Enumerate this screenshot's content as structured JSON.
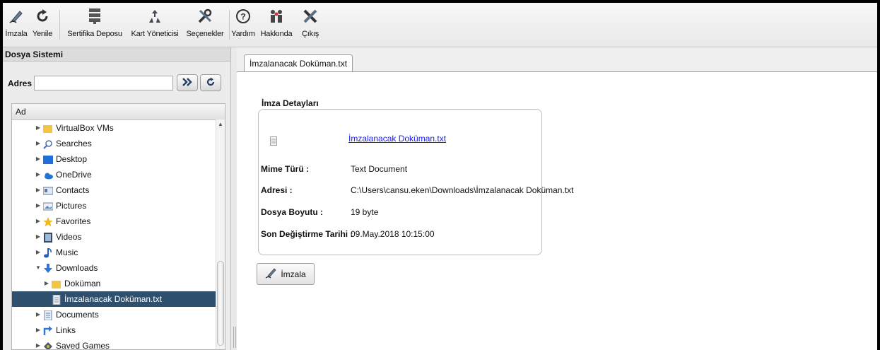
{
  "toolbar": {
    "items": [
      {
        "label": "İmzala",
        "icon": "sign-pen-icon"
      },
      {
        "label": "Yenile",
        "icon": "refresh-icon"
      },
      {
        "label": "Sertifika Deposu",
        "icon": "certificate-store-icon"
      },
      {
        "label": "Kart Yöneticisi",
        "icon": "card-manager-icon"
      },
      {
        "label": "Seçenekler",
        "icon": "wrench-icon"
      },
      {
        "label": "Yardım",
        "icon": "help-icon"
      },
      {
        "label": "Hakkında",
        "icon": "about-icon"
      },
      {
        "label": "Çıkış",
        "icon": "exit-icon"
      }
    ]
  },
  "left_panel": {
    "title": "Dosya Sistemi",
    "address_label": "Adres :",
    "address_value": "",
    "column_header": "Ad",
    "tree": [
      {
        "label": "VirtualBox VMs",
        "icon": "folder-icon",
        "expander": "collapsed",
        "level": 1
      },
      {
        "label": "Searches",
        "icon": "search-icon",
        "expander": "collapsed",
        "level": 1
      },
      {
        "label": "Desktop",
        "icon": "desktop-icon",
        "expander": "collapsed",
        "level": 1
      },
      {
        "label": "OneDrive",
        "icon": "cloud-icon",
        "expander": "collapsed",
        "level": 1
      },
      {
        "label": "Contacts",
        "icon": "contacts-icon",
        "expander": "collapsed",
        "level": 1
      },
      {
        "label": "Pictures",
        "icon": "pictures-icon",
        "expander": "collapsed",
        "level": 1
      },
      {
        "label": "Favorites",
        "icon": "star-icon",
        "expander": "collapsed",
        "level": 1
      },
      {
        "label": "Videos",
        "icon": "video-icon",
        "expander": "collapsed",
        "level": 1
      },
      {
        "label": "Music",
        "icon": "music-note-icon",
        "expander": "collapsed",
        "level": 1
      },
      {
        "label": "Downloads",
        "icon": "download-arrow-icon",
        "expander": "expanded",
        "level": 1
      },
      {
        "label": "Doküman",
        "icon": "folder-icon",
        "expander": "collapsed",
        "level": 2
      },
      {
        "label": "İmzalanacak Doküman.txt",
        "icon": "text-file-icon",
        "expander": "none",
        "level": 2,
        "selected": true
      },
      {
        "label": "Documents",
        "icon": "documents-icon",
        "expander": "collapsed",
        "level": 1
      },
      {
        "label": "Links",
        "icon": "links-icon",
        "expander": "collapsed",
        "level": 1
      },
      {
        "label": "Saved Games",
        "icon": "saved-games-icon",
        "expander": "collapsed",
        "level": 1
      }
    ]
  },
  "tab": {
    "label": "İmzalanacak Doküman.txt"
  },
  "details": {
    "title": "İmza Detayları",
    "file_link": "İmzalanacak Doküman.txt",
    "fields": [
      {
        "label": "Mime Türü :",
        "value": "Text Document"
      },
      {
        "label": "Adresi :",
        "value": "C:\\Users\\cansu.eken\\Downloads\\İmzalanacak Doküman.txt"
      },
      {
        "label": "Dosya Boyutu :",
        "value": "19 byte"
      },
      {
        "label": "Son Değiştirme Tarihi :",
        "value": "09.May.2018 10:15:00"
      }
    ],
    "sign_button": "İmzala"
  },
  "colors": {
    "selection": "#2f4f6e",
    "link": "#1a1aee",
    "folder": "#f5c542"
  }
}
